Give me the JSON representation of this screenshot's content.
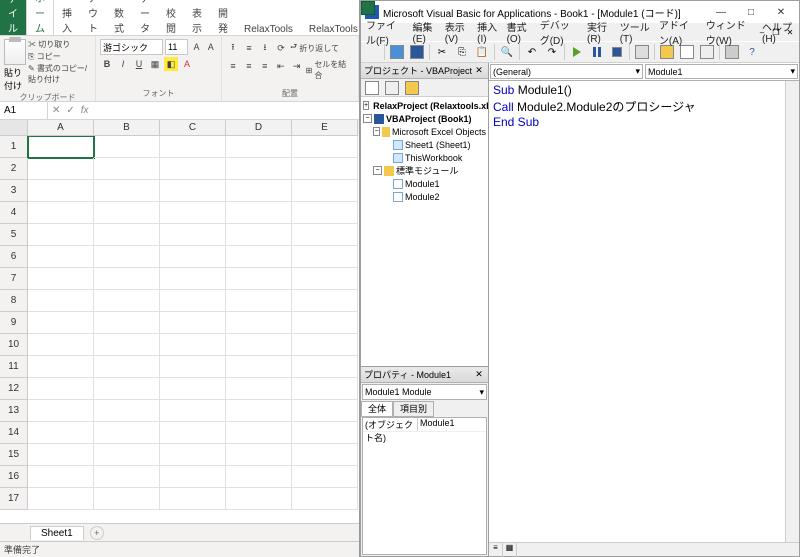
{
  "excel": {
    "qat": {
      "undo": "↶",
      "redo": "↷"
    },
    "tabs": [
      "ファイル",
      "ホーム",
      "挿入",
      "ページ レイアウト",
      "数式",
      "データ",
      "校閲",
      "表示",
      "開発",
      "RelaxTools",
      "RelaxTools"
    ],
    "active_tab": "ホーム",
    "clipboard": {
      "paste": "貼り付け",
      "cut": "切り取り",
      "copy": "コピー",
      "format": "書式のコピー/貼り付け",
      "group": "クリップボード"
    },
    "font": {
      "name": "游ゴシック",
      "size": "11",
      "group": "フォント"
    },
    "align": {
      "wrap": "折り返して",
      "merge": "セルを結合",
      "group": "配置"
    },
    "namebox": "A1",
    "columns": [
      "A",
      "B",
      "C",
      "D",
      "E"
    ],
    "rows": [
      "1",
      "2",
      "3",
      "4",
      "5",
      "6",
      "7",
      "8",
      "9",
      "10",
      "11",
      "12",
      "13",
      "14",
      "15",
      "16",
      "17"
    ],
    "sheet": "Sheet1",
    "status": "準備完了"
  },
  "vbe": {
    "title": "Microsoft Visual Basic for Applications - Book1 - [Module1 (コード)]",
    "menu": [
      "ファイル(F)",
      "編集(E)",
      "表示(V)",
      "挿入(I)",
      "書式(O)",
      "デバッグ(D)",
      "実行(R)",
      "ツール(T)",
      "アドイン(A)",
      "ウィンドウ(W)",
      "ヘルプ(H)"
    ],
    "project": {
      "title": "プロジェクト - VBAProject",
      "tree": {
        "relax": "RelaxProject (Relaxtools.xlam)",
        "book": "VBAProject (Book1)",
        "excel_objects": "Microsoft Excel Objects",
        "sheet1": "Sheet1 (Sheet1)",
        "thiswb": "ThisWorkbook",
        "std_modules": "標準モジュール",
        "mod1": "Module1",
        "mod2": "Module2"
      }
    },
    "properties": {
      "title": "プロパティ - Module1",
      "combo": "Module1  Module",
      "tab_all": "全体",
      "tab_cat": "項目別",
      "name_key": "(オブジェクト名)",
      "name_val": "Module1"
    },
    "code": {
      "combo_left": "(General)",
      "combo_right": "Module1",
      "lines": {
        "l1a": "Sub",
        "l1b": " Module1()",
        "l2a": "Call",
        "l2b": " Module2.Module2のプロシージャ",
        "l3": "End Sub"
      }
    }
  }
}
